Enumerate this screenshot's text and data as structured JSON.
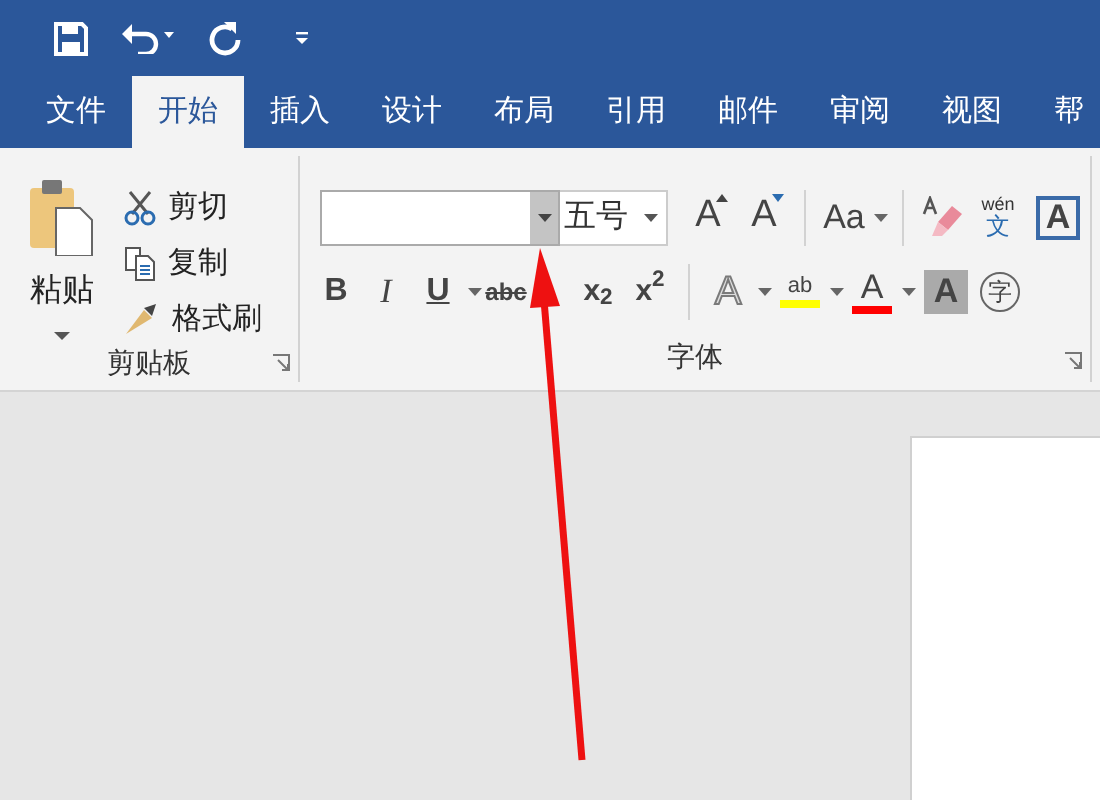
{
  "tabs": [
    {
      "label": "文件",
      "selected": false
    },
    {
      "label": "开始",
      "selected": true
    },
    {
      "label": "插入",
      "selected": false
    },
    {
      "label": "设计",
      "selected": false
    },
    {
      "label": "布局",
      "selected": false
    },
    {
      "label": "引用",
      "selected": false
    },
    {
      "label": "邮件",
      "selected": false
    },
    {
      "label": "审阅",
      "selected": false
    },
    {
      "label": "视图",
      "selected": false
    },
    {
      "label": "帮",
      "selected": false
    }
  ],
  "clipboard": {
    "paste": "粘贴",
    "commands": [
      {
        "kind": "cut",
        "label": "剪切"
      },
      {
        "kind": "copy",
        "label": "复制"
      },
      {
        "kind": "painter",
        "label": "格式刷"
      }
    ],
    "group_label": "剪贴板"
  },
  "font": {
    "size": "五号",
    "group_label": "字体",
    "row1": [
      {
        "kind": "grow",
        "text": "A"
      },
      {
        "kind": "shrink",
        "text": "A"
      },
      {
        "kind": "case",
        "text": "Aa"
      },
      {
        "kind": "clear"
      },
      {
        "kind": "phonetic",
        "text": "wén",
        "sub": "文"
      },
      {
        "kind": "border",
        "text": "A"
      }
    ],
    "row2": [
      {
        "kind": "bold",
        "text": "B"
      },
      {
        "kind": "italic",
        "text": "I"
      },
      {
        "kind": "underline",
        "text": "U"
      },
      {
        "kind": "strike",
        "text": "abc"
      },
      {
        "kind": "script",
        "text": "x$_{2}$"
      },
      {
        "kind": "script",
        "text": "x$^{2}$"
      },
      {
        "kind": "effects",
        "text": "A"
      },
      {
        "kind": "highlight",
        "text": "ab",
        "color": "#ffff00"
      },
      {
        "kind": "fontcolor",
        "text": "A",
        "color": "#ff0000"
      },
      {
        "kind": "shading",
        "text": "A"
      },
      {
        "kind": "enclose",
        "text": "字"
      }
    ]
  }
}
